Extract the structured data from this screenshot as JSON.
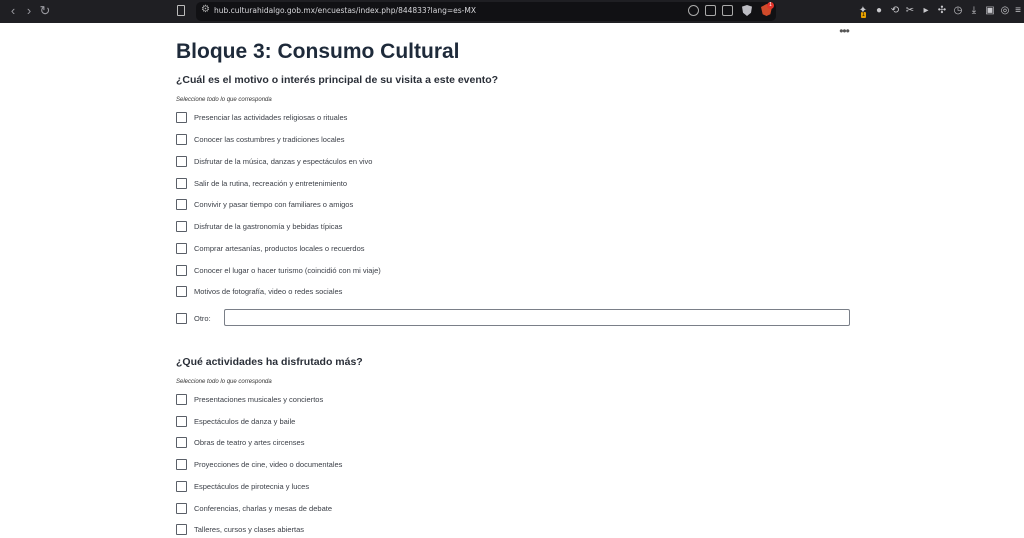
{
  "browser": {
    "url": "hub.culturahidalgo.gob.mx/encuestas/index.php/844833?lang=es-MX",
    "shields_count": "1",
    "extension_badge": "1"
  },
  "page": {
    "title": "Bloque 3: Consumo Cultural"
  },
  "q1": {
    "question": "¿Cuál es el motivo o interés principal de su visita a este evento?",
    "hint": "Seleccione todo lo que corresponda",
    "options": [
      "Presenciar las actividades religiosas o rituales",
      "Conocer las costumbres y tradiciones locales",
      "Disfrutar de la música, danzas y espectáculos en vivo",
      "Salir de la rutina, recreación y entretenimiento",
      "Convivir y pasar tiempo con familiares o amigos",
      "Disfrutar de la gastronomía y bebidas típicas",
      "Comprar artesanías, productos locales o recuerdos",
      "Conocer el lugar o hacer turismo (coincidió con mi viaje)",
      "Motivos de fotografía, video o redes sociales"
    ],
    "other_label": "Otro:",
    "other_value": ""
  },
  "q2": {
    "question": "¿Qué actividades ha disfrutado más?",
    "hint": "Seleccione todo lo que corresponda",
    "options": [
      "Presentaciones musicales y conciertos",
      "Espectáculos de danza y baile",
      "Obras de teatro y artes circenses",
      "Proyecciones de cine, video o documentales",
      "Espectáculos de pirotecnia y luces",
      "Conferencias, charlas y mesas de debate",
      "Talleres, cursos y clases abiertas"
    ]
  }
}
